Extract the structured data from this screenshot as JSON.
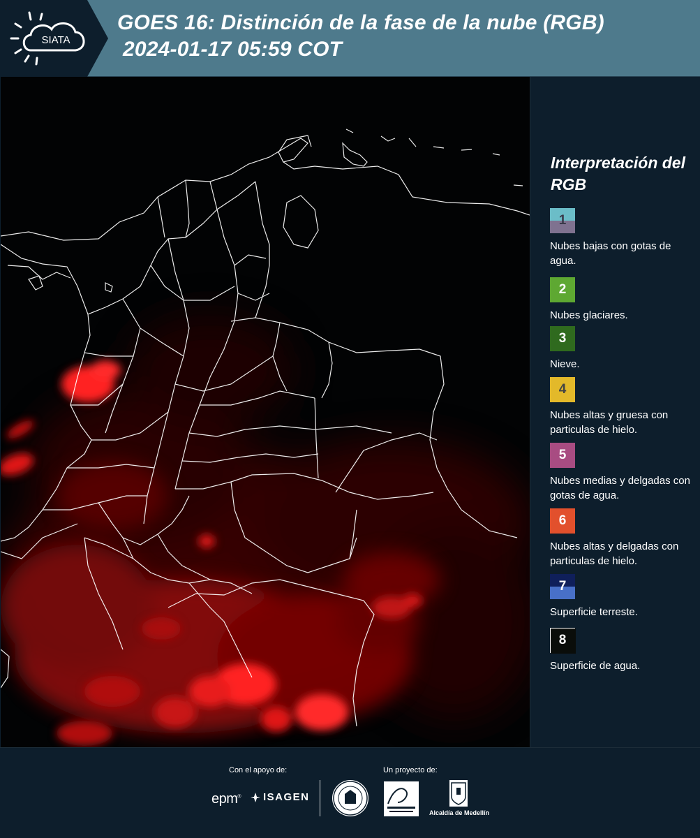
{
  "header": {
    "logo_text": "SIATA",
    "title_line1": "GOES 16: Distinción de la fase de la nube (RGB)",
    "title_line2": "2024-01-17 05:59 COT"
  },
  "legend": {
    "title": "Interpretación del RGB",
    "items": [
      {
        "number": "1",
        "label": "Nubes bajas con gotas de agua.",
        "color_top": "#6bbdc8",
        "color_bottom": "#7f7290",
        "number_color": "#3a3a4a"
      },
      {
        "number": "2",
        "label": "Nubes glaciares.",
        "color_top": "#5ea832",
        "color_bottom": "#5ea832",
        "number_color": "#ffffff"
      },
      {
        "number": "3",
        "label": "Nieve.",
        "color_top": "#2f6a1e",
        "color_bottom": "#2f6a1e",
        "number_color": "#ffffff"
      },
      {
        "number": "4",
        "label": "Nubes altas y gruesa con particulas de hielo.",
        "color_top": "#e3b92a",
        "color_bottom": "#e3b92a",
        "number_color": "#444444"
      },
      {
        "number": "5",
        "label": "Nubes medias y delgadas con gotas de agua.",
        "color_top": "#a84c82",
        "color_bottom": "#a84c82",
        "number_color": "#ffffff"
      },
      {
        "number": "6",
        "label": "Nubes altas y delgadas con particulas de hielo.",
        "color_top": "#e2502c",
        "color_bottom": "#e2502c",
        "number_color": "#ffffff"
      },
      {
        "number": "7",
        "label": "Superficie terreste.",
        "color_top": "#0f1f5a",
        "color_bottom": "#4870c8",
        "number_color": "#ffffff"
      },
      {
        "number": "8",
        "label": "Superficie de agua.",
        "color_top": "#0a0d0a",
        "color_bottom": "#0a0d0a",
        "number_color": "#ffffff"
      }
    ]
  },
  "footer": {
    "support_label": "Con el apoyo de:",
    "project_label": "Un proyecto de:",
    "epm": "epm",
    "isagen": "ISAGEN",
    "alcaldia": "Alcaldía de Medellín"
  },
  "colors": {
    "header_bg": "#4e7a8c",
    "panel_bg": "#0d1e2c",
    "map_bg": "#020304",
    "cloud_red": "#ff1a1a",
    "border_white": "#ffffff"
  }
}
